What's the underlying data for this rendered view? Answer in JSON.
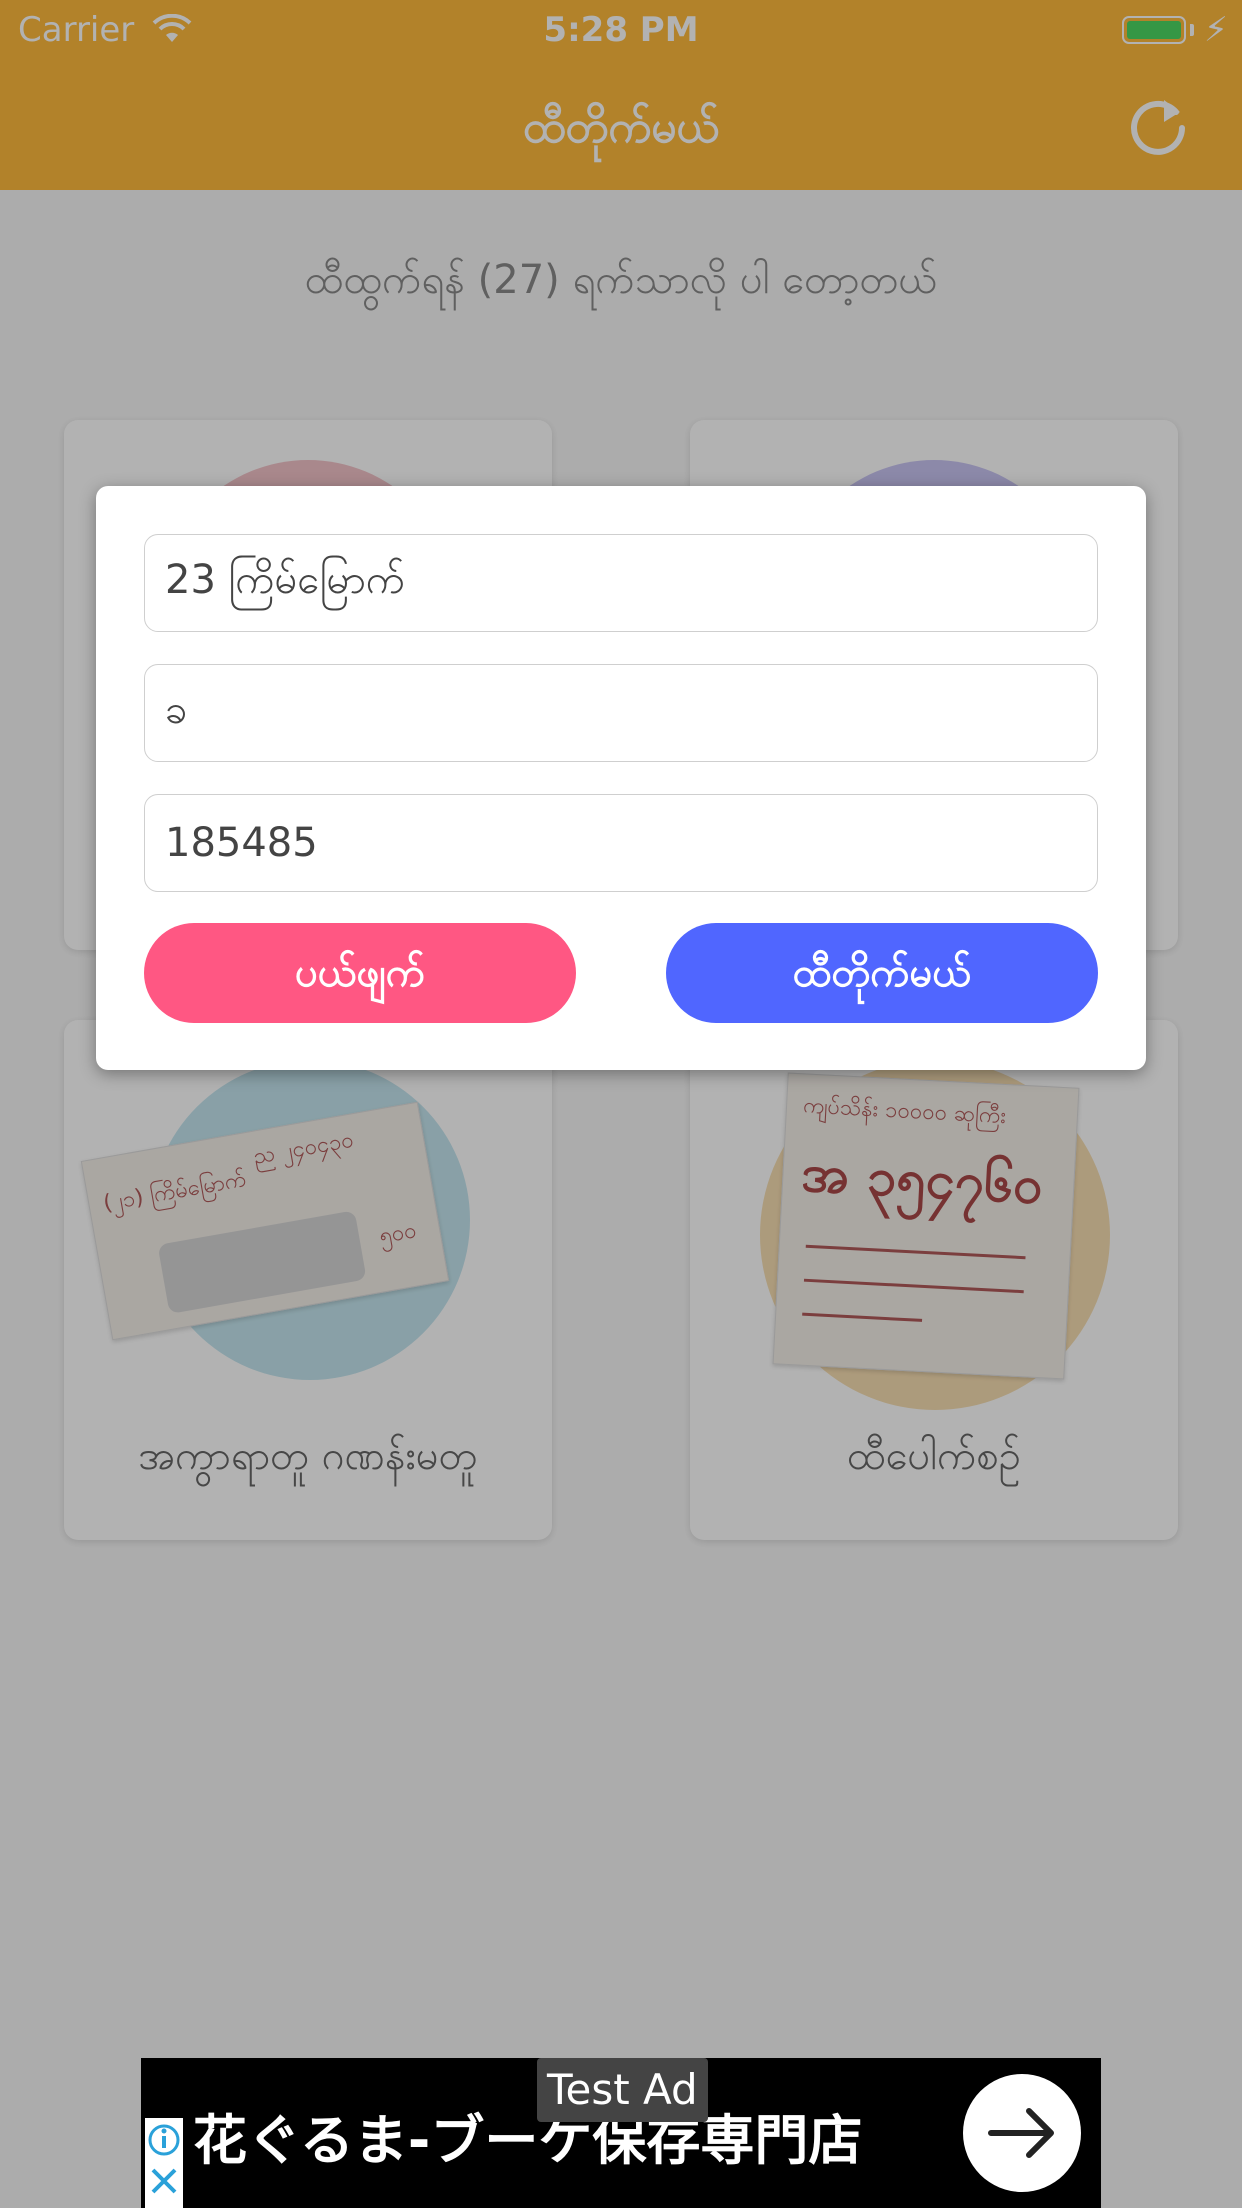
{
  "status_bar": {
    "carrier": "Carrier",
    "time": "5:28 PM"
  },
  "nav": {
    "title": "ထီတိုက်မယ်",
    "refresh_icon": "refresh-icon"
  },
  "main": {
    "subtitle": "ထီထွက်ရန် (27) ရက်သာလို ပါ တော့တယ်",
    "cards": [
      {
        "label": ""
      },
      {
        "label": ""
      },
      {
        "label": "အကွာရာတူ ဂဏန်းမတူ",
        "ticket_lines": [
          "(၂၁) ကြိမ်မြောက်",
          "ည ၂၄၀၄၃၀",
          "၅၀၀"
        ]
      },
      {
        "label": "ထီပေါက်စဉ်",
        "ticket_lines": [
          "ကျပ်သိန်း ၁၀၀၀၀ ဆုကြီး",
          "အ ၃၅၄၇၆၀"
        ]
      }
    ]
  },
  "dialog": {
    "field_draw": "23 ကြိမ်မြောက်",
    "field_letter": "ခ",
    "field_number": "185485",
    "cancel_label": "ပယ်ဖျက်",
    "check_label": "ထီတိုက်မယ်"
  },
  "ad": {
    "tag": "Test Ad",
    "headline": "花ぐるま-ブーケ保存専門店"
  },
  "colors": {
    "header": "#ffbb3d",
    "cancel": "#ff5783",
    "check": "#5066ff"
  }
}
